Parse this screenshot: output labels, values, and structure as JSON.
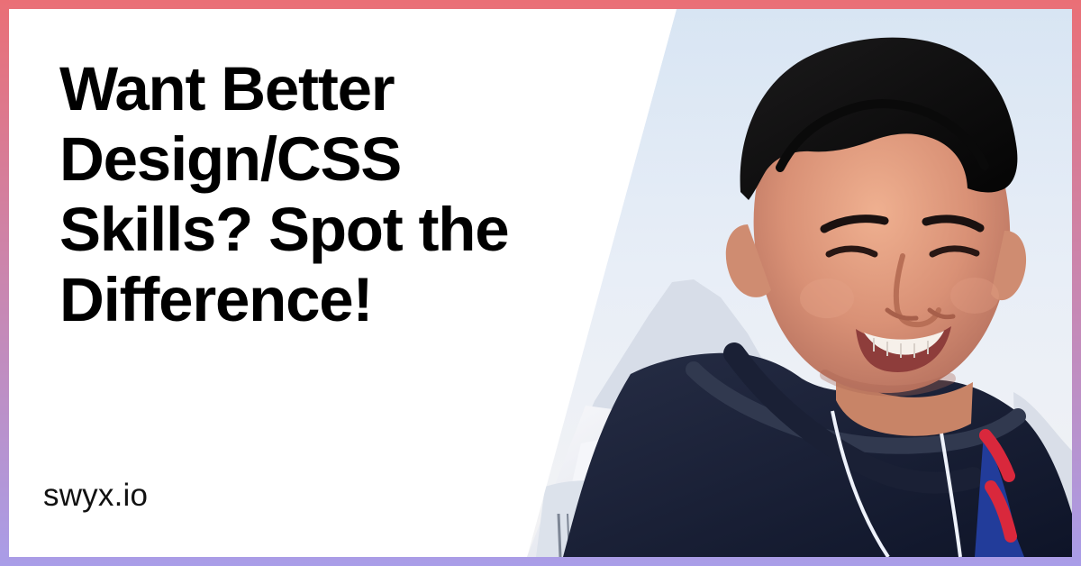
{
  "headline": {
    "lines": [
      "Want Better",
      "Design/CSS",
      "Skills? Spot the",
      "Difference!"
    ]
  },
  "footer": {
    "site": "swyx.io"
  },
  "colors": {
    "gradient_top": "#ea6f76",
    "gradient_bottom": "#a99de8"
  },
  "icons": {
    "portrait": "smiling-person-photo"
  }
}
